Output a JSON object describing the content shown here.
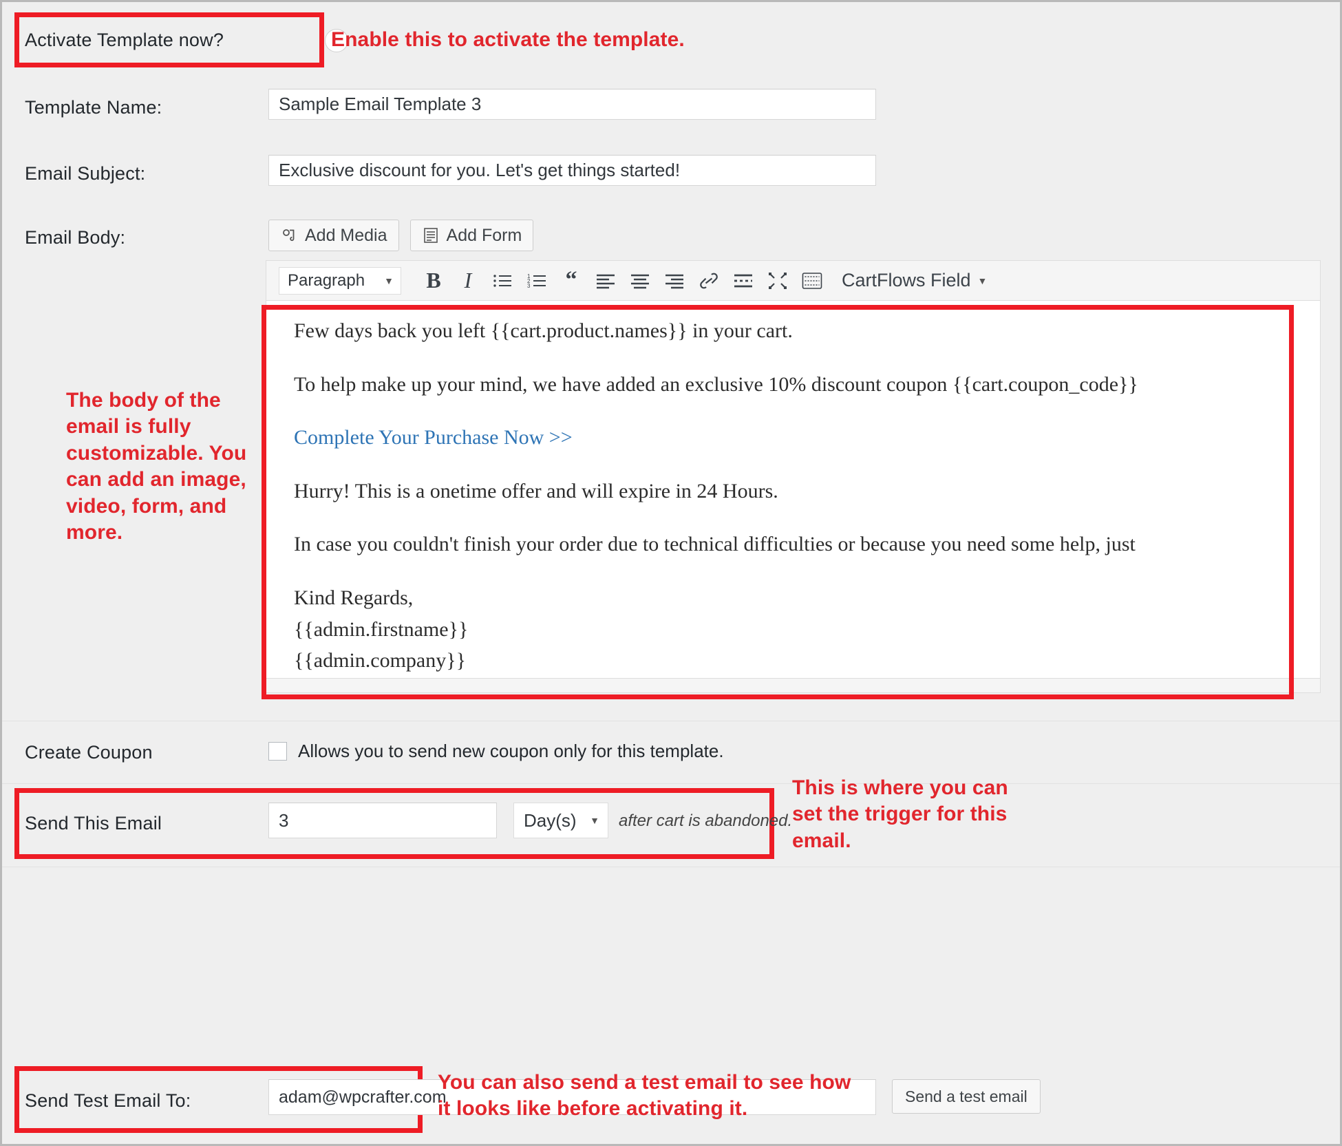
{
  "activate": {
    "label": "Activate Template now?",
    "toggle_on": false,
    "annotation": "Enable this to activate the template."
  },
  "template_name": {
    "label": "Template Name:",
    "value": "Sample Email Template 3"
  },
  "email_subject": {
    "label": "Email Subject:",
    "value": "Exclusive discount for you. Let's get things started!"
  },
  "email_body": {
    "label": "Email Body:",
    "add_media": "Add Media",
    "add_form": "Add Form",
    "annotation": "The body of the email is fully customizable. You can add an image, video, form, and more.",
    "toolbar": {
      "format": "Paragraph",
      "bold": "B",
      "italic": "I",
      "cartflows_field": "CartFlows Field",
      "icons": [
        "bold-icon",
        "italic-icon",
        "bulleted-list-icon",
        "numbered-list-icon",
        "blockquote-icon",
        "align-left-icon",
        "align-center-icon",
        "align-right-icon",
        "link-icon",
        "read-more-icon",
        "fullscreen-icon",
        "toolbar-toggle-icon"
      ]
    },
    "paragraphs": [
      "Few days back you left {{cart.product.names}} in your cart.",
      "To help make up your mind, we have added an exclusive 10% discount coupon {{cart.coupon_code}}",
      "Complete Your Purchase Now >>",
      "Hurry! This is a onetime offer and will expire in 24 Hours.",
      "In case you couldn't finish your order due to technical difficulties or because you need some help, just",
      "Kind Regards,",
      "{{admin.firstname}}",
      "{{admin.company}}"
    ]
  },
  "create_coupon": {
    "label": "Create Coupon",
    "checkbox_label": "Allows you to send new coupon only for this template.",
    "checked": false
  },
  "send_this_email": {
    "label": "Send This Email",
    "value": "3",
    "unit": "Day(s)",
    "suffix": "after cart is abandoned.",
    "annotation": "This is where you can set the trigger for this email."
  },
  "send_test_email": {
    "label": "Send Test Email To:",
    "value": "adam@wpcrafter.com",
    "button": "Send a test email",
    "annotation": "You can also send a test email to see how it looks like before activating it."
  },
  "colors": {
    "annotation_red": "#e1262d",
    "box_red": "#ee1c25",
    "page_bg": "#efefef",
    "link_blue": "#2e74b5"
  }
}
